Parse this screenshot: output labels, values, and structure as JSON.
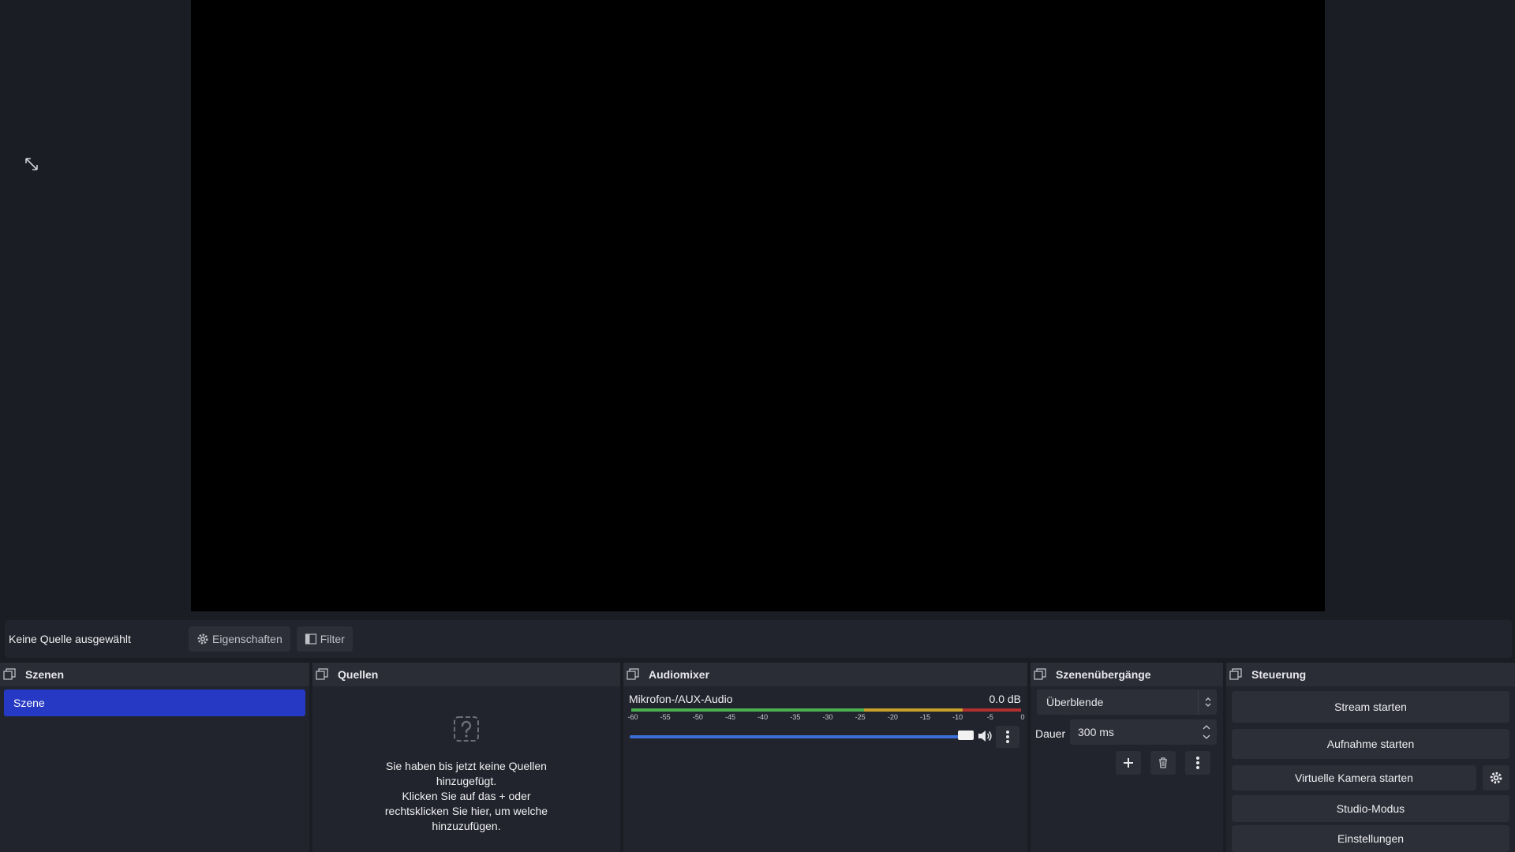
{
  "context_bar": {
    "no_source": "Keine Quelle ausgewählt",
    "properties_label": "Eigenschaften",
    "filter_label": "Filter"
  },
  "docks": {
    "scenes": {
      "title": "Szenen",
      "items": [
        "Szene"
      ]
    },
    "sources": {
      "title": "Quellen",
      "empty_text": "Sie haben bis jetzt keine Quellen\nhinzugefügt.\nKlicken Sie auf das + oder\nrechtsklicken Sie hier, um welche\nhinzuzufügen."
    },
    "mixer": {
      "title": "Audiomixer",
      "channel_name": "Mikrofon-/AUX-Audio",
      "db_value": "0.0 dB",
      "ticks": [
        "-60",
        "-55",
        "-50",
        "-45",
        "-40",
        "-35",
        "-30",
        "-25",
        "-20",
        "-15",
        "-10",
        "-5",
        "0"
      ],
      "volume_fraction": 1.0
    },
    "transitions": {
      "title": "Szenenübergänge",
      "selected": "Überblende",
      "duration_label": "Dauer",
      "duration_value": "300 ms"
    },
    "controls": {
      "title": "Steuerung",
      "stream": "Stream starten",
      "record": "Aufnahme starten",
      "virtual_cam": "Virtuelle Kamera starten",
      "studio_mode": "Studio-Modus",
      "settings": "Einstellungen"
    }
  },
  "colors": {
    "accent": "#2639c4",
    "meter_green": "#4caf50",
    "meter_yellow": "#c8a02a",
    "meter_red": "#b03030",
    "fader": "#3a6fd8"
  }
}
